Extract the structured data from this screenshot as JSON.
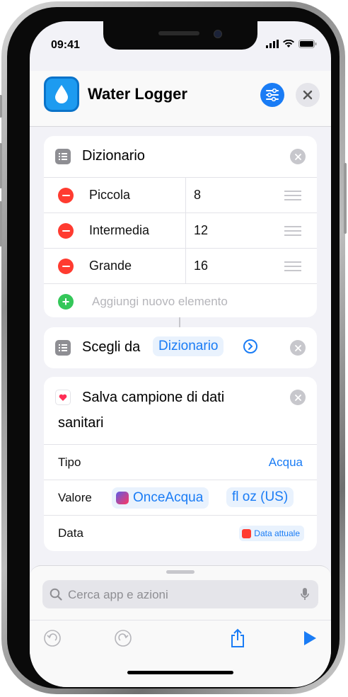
{
  "status_bar": {
    "time": "09:41"
  },
  "header": {
    "title": "Water Logger"
  },
  "dictionary_action": {
    "title": "Dizionario",
    "items": [
      {
        "key": "Piccola",
        "value": "8"
      },
      {
        "key": "Intermedia",
        "value": "12"
      },
      {
        "key": "Grande",
        "value": "16"
      }
    ],
    "add_placeholder": "Aggiungi nuovo elemento"
  },
  "choose_action": {
    "label": "Scegli da",
    "token": "Dizionario"
  },
  "health_action": {
    "title_line1": "Salva campione di dati",
    "title_line2": "sanitari",
    "rows": {
      "tipo_label": "Tipo",
      "tipo_value": "Acqua",
      "valore_label": "Valore",
      "valore_token": "OnceAcqua",
      "valore_unit": "fl oz (US)",
      "data_label": "Data",
      "data_token": "Data attuale"
    }
  },
  "search": {
    "placeholder": "Cerca app e azioni"
  },
  "colors": {
    "accent": "#1a7cf5",
    "remove": "#ff3b30",
    "add": "#34c759",
    "app_icon": "#1d9bf0"
  }
}
